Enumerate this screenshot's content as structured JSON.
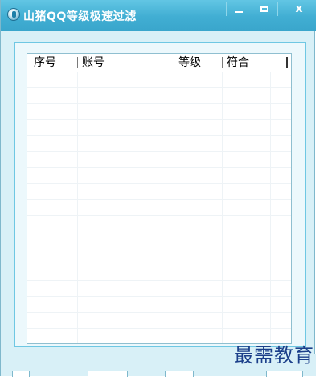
{
  "window": {
    "title": "山猪QQ等级极速过滤",
    "buttons": {
      "minimize_icon": "minimize-icon",
      "maximize_icon": "maximize-icon",
      "close_label": "x"
    },
    "colors": {
      "titlebar": "#41aed3",
      "frame": "#d8f0f7",
      "border": "#6ec7e3"
    }
  },
  "table": {
    "columns": [
      "序号",
      "账号",
      "等级",
      "符合"
    ],
    "rows": []
  },
  "watermark": "最需教育"
}
